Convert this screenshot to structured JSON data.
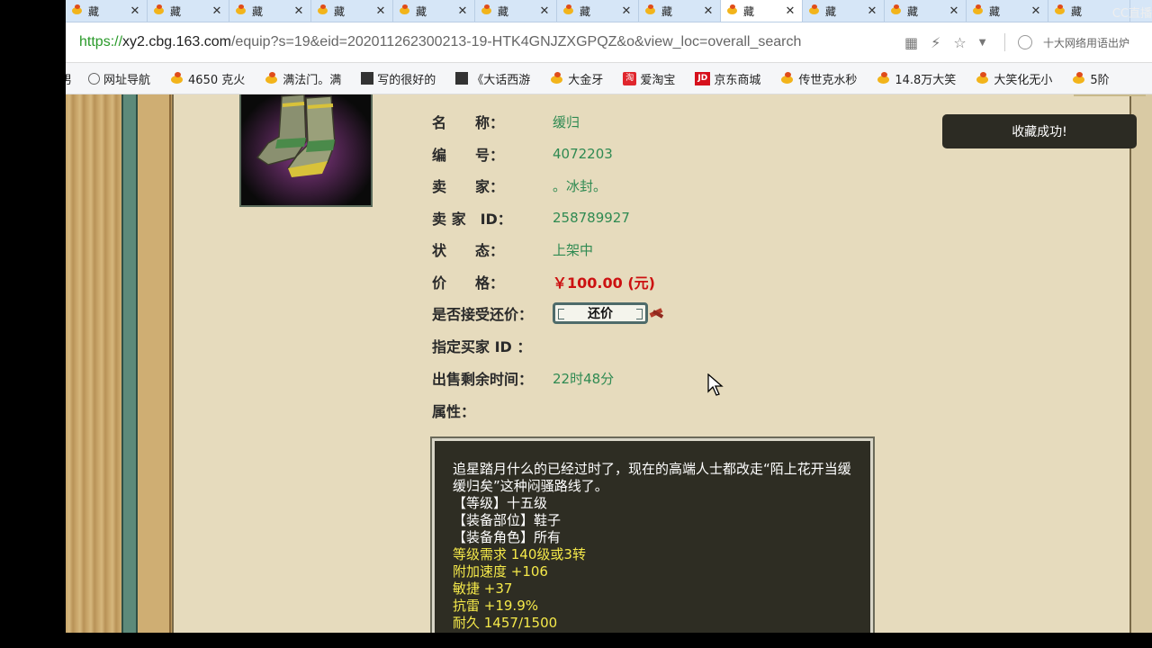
{
  "tabs": [
    {
      "label": "藏"
    },
    {
      "label": "藏"
    },
    {
      "label": "藏"
    },
    {
      "label": "藏"
    },
    {
      "label": "藏"
    },
    {
      "label": "藏"
    },
    {
      "label": "藏"
    },
    {
      "label": "藏"
    },
    {
      "label": "藏",
      "active": true
    },
    {
      "label": "藏"
    },
    {
      "label": "藏"
    },
    {
      "label": "藏"
    },
    {
      "label": "藏"
    }
  ],
  "watermark": "CC直播",
  "address": {
    "protocol": "https://",
    "host": "xy2.cbg.163.com",
    "path": "/equip?s=19&eid=202011262300213-19-HTK4GNJZXGPQZ&o&view_loc=overall_search"
  },
  "search_hint": "十大网络用语出炉",
  "bookmarks": [
    {
      "label": "网址导航",
      "icon": "globe-icon"
    },
    {
      "label": "4650 克火",
      "icon": "star-icon"
    },
    {
      "label": "满法门。满",
      "icon": "star-icon"
    },
    {
      "label": "写的很好的",
      "icon": "page-icon"
    },
    {
      "label": "《大话西游",
      "icon": "page-icon"
    },
    {
      "label": "大金牙",
      "icon": "star-icon"
    },
    {
      "label": "爱淘宝",
      "icon": "taobao-icon"
    },
    {
      "label": "京东商城",
      "icon": "jd-icon"
    },
    {
      "label": "传世克水秒",
      "icon": "star-icon"
    },
    {
      "label": "14.8万大笑",
      "icon": "star-icon"
    },
    {
      "label": "大笑化无小",
      "icon": "star-icon"
    },
    {
      "label": "5阶",
      "icon": "star-icon"
    }
  ],
  "item": {
    "fields": [
      {
        "label": "名　　称：",
        "value": "缓归"
      },
      {
        "label": "编　　号：",
        "value": "4072203"
      },
      {
        "label": "卖　　家：",
        "value": "。冰封。"
      },
      {
        "label": "卖 家　ID：",
        "value": "258789927"
      },
      {
        "label": "状　　态：",
        "value": "上架中"
      },
      {
        "label": "价　　格：",
        "value": "￥100.00 (元)"
      },
      {
        "label": "是否接受还价：",
        "value": ""
      },
      {
        "label": "指定买家 ID ：",
        "value": ""
      },
      {
        "label": "出售剩余时间：",
        "value": "22时48分"
      },
      {
        "label": "属性：",
        "value": ""
      }
    ],
    "counter_offer_label": "还价"
  },
  "description": {
    "intro": "追星踏月什么的已经过时了，现在的高端人士都改走“陌上花开当缓缓归矣”这种闷骚路线了。",
    "white_lines": [
      "【等级】十五级",
      "【装备部位】鞋子",
      "【装备角色】所有"
    ],
    "yellow_lines": [
      "等级需求 140级或3转",
      "附加速度 +106",
      "敏捷 +37",
      "抗雷 +19.9%",
      "耐久 1457/1500"
    ]
  },
  "toast": "收藏成功!",
  "colors": {
    "accent_green": "#2f8a52",
    "price_red": "#cc1111",
    "desc_bg": "#2e2d23",
    "desc_yellow": "#f5e94a"
  }
}
